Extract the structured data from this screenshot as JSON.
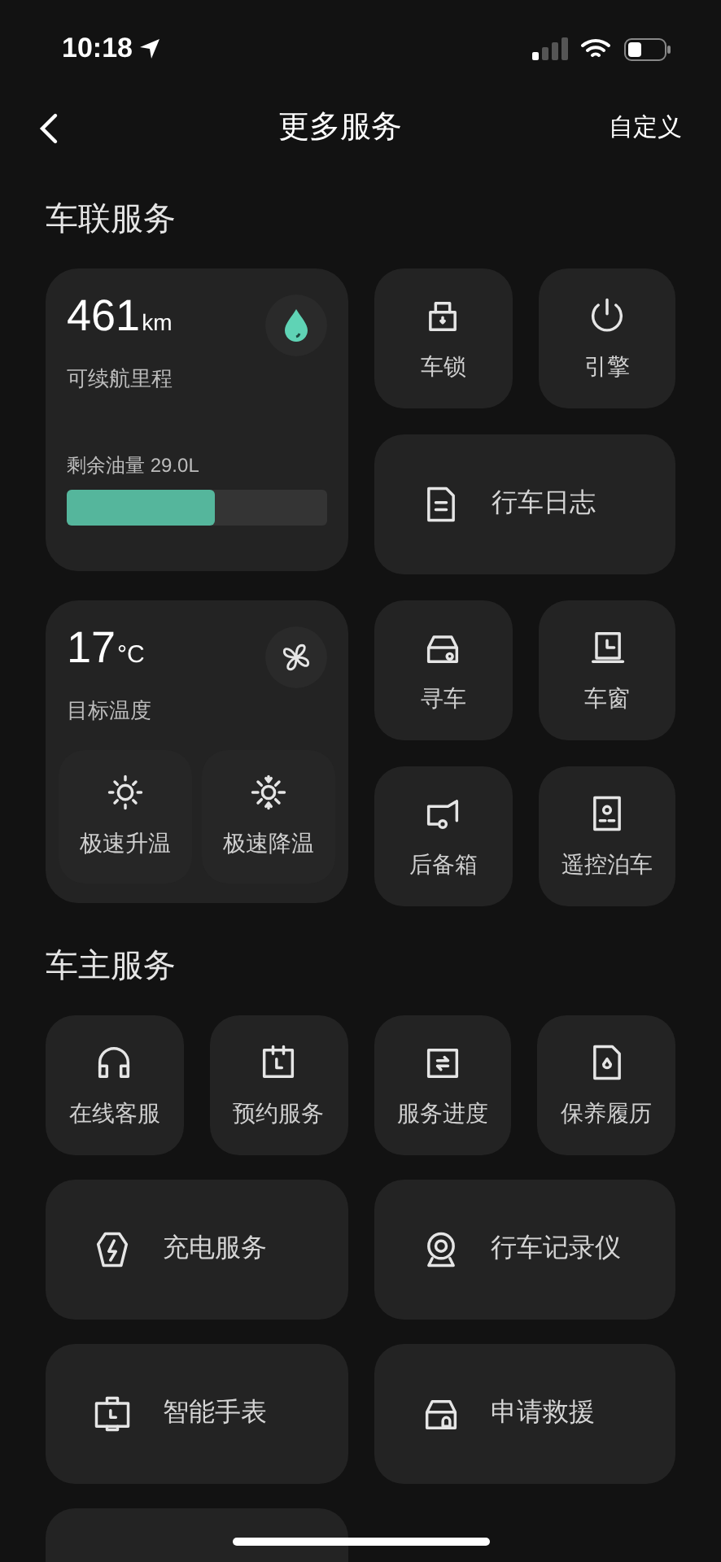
{
  "status_bar": {
    "time": "10:18"
  },
  "header": {
    "title": "更多服务",
    "action": "自定义"
  },
  "vehicle_services": {
    "title": "车联服务",
    "blocks": [
      {
        "card": {
          "kind": "range",
          "value": "461",
          "unit": "km",
          "label": "可续航里程",
          "fuel_label": "剩余油量 29.0L",
          "level": 0.57
        },
        "tiles": [
          {
            "label": "车锁",
            "kind": "small"
          },
          {
            "label": "引擎",
            "kind": "small"
          },
          {
            "label": "行车日志",
            "kind": "wide"
          }
        ]
      },
      {
        "card": {
          "kind": "climate",
          "value": "17",
          "unit": "°C",
          "label": "目标温度",
          "buttons": [
            "极速升温",
            "极速降温"
          ]
        },
        "tiles": [
          {
            "label": "寻车",
            "kind": "small"
          },
          {
            "label": "车窗",
            "kind": "small"
          },
          {
            "label": "后备箱",
            "kind": "small"
          },
          {
            "label": "遥控泊车",
            "kind": "small"
          }
        ]
      }
    ]
  },
  "owner_services": {
    "title": "车主服务",
    "tiles": [
      {
        "label": "在线客服",
        "kind": "small"
      },
      {
        "label": "预约服务",
        "kind": "small"
      },
      {
        "label": "服务进度",
        "kind": "small"
      },
      {
        "label": "保养履历",
        "kind": "small"
      },
      {
        "label": "充电服务",
        "kind": "wide"
      },
      {
        "label": "行车记录仪",
        "kind": "wide"
      },
      {
        "label": "智能手表",
        "kind": "wide"
      },
      {
        "label": "申请救援",
        "kind": "wide"
      }
    ]
  }
}
